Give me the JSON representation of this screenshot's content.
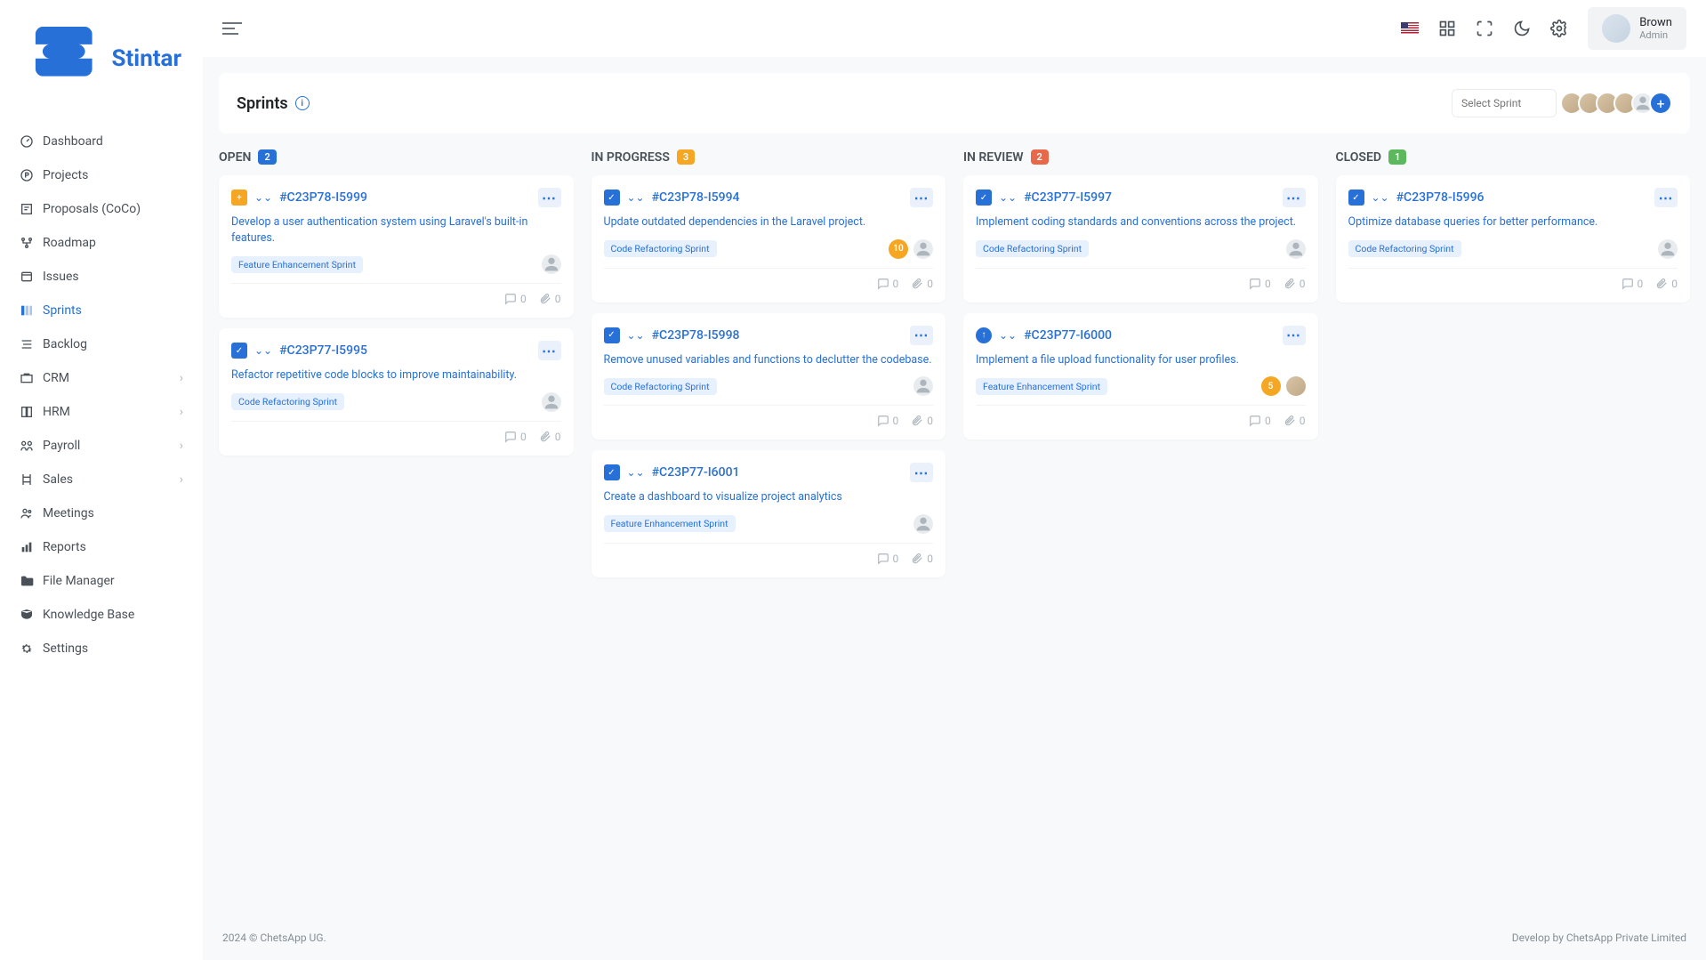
{
  "app": {
    "name": "Stintar"
  },
  "user": {
    "name": "Brown",
    "role": "Admin"
  },
  "sidebar": {
    "items": [
      {
        "label": "Dashboard",
        "icon": "gauge"
      },
      {
        "label": "Projects",
        "icon": "p-circle"
      },
      {
        "label": "Proposals (CoCo)",
        "icon": "proposal"
      },
      {
        "label": "Roadmap",
        "icon": "roadmap"
      },
      {
        "label": "Issues",
        "icon": "issues"
      },
      {
        "label": "Sprints",
        "icon": "sprints",
        "active": true
      },
      {
        "label": "Backlog",
        "icon": "backlog"
      },
      {
        "label": "CRM",
        "icon": "crm",
        "expandable": true
      },
      {
        "label": "HRM",
        "icon": "hrm",
        "expandable": true
      },
      {
        "label": "Payroll",
        "icon": "payroll",
        "expandable": true
      },
      {
        "label": "Sales",
        "icon": "sales",
        "expandable": true
      },
      {
        "label": "Meetings",
        "icon": "meetings"
      },
      {
        "label": "Reports",
        "icon": "reports"
      },
      {
        "label": "File Manager",
        "icon": "folder"
      },
      {
        "label": "Knowledge Base",
        "icon": "kb"
      },
      {
        "label": "Settings",
        "icon": "gear"
      }
    ]
  },
  "page": {
    "title": "Sprints",
    "select_placeholder": "Select Sprint"
  },
  "columns": [
    {
      "title": "OPEN",
      "count": "2",
      "badge": "blue"
    },
    {
      "title": "IN PROGRESS",
      "count": "3",
      "badge": "orange"
    },
    {
      "title": "IN REVIEW",
      "count": "2",
      "badge": "red"
    },
    {
      "title": "CLOSED",
      "count": "1",
      "badge": "green"
    }
  ],
  "cards": {
    "open": [
      {
        "id": "#C23P78-I5999",
        "type": "new",
        "desc": "Develop a user authentication system using Laravel's built-in features.",
        "tag": "Feature Enhancement Sprint",
        "comments": "0",
        "attachments": "0"
      },
      {
        "id": "#C23P77-I5995",
        "type": "task",
        "desc": "Refactor repetitive code blocks to improve maintainability.",
        "tag": "Code Refactoring Sprint",
        "comments": "0",
        "attachments": "0"
      }
    ],
    "inprogress": [
      {
        "id": "#C23P78-I5994",
        "type": "task",
        "desc": "Update outdated dependencies in the Laravel project.",
        "tag": "Code Refactoring Sprint",
        "count": "10",
        "countColor": "y",
        "comments": "0",
        "attachments": "0"
      },
      {
        "id": "#C23P78-I5998",
        "type": "task",
        "desc": "Remove unused variables and functions to declutter the codebase.",
        "tag": "Code Refactoring Sprint",
        "comments": "0",
        "attachments": "0"
      },
      {
        "id": "#C23P77-I6001",
        "type": "task",
        "desc": "Create a dashboard to visualize project analytics",
        "tag": "Feature Enhancement Sprint",
        "comments": "0",
        "attachments": "0"
      }
    ],
    "inreview": [
      {
        "id": "#C23P77-I5997",
        "type": "task",
        "desc": "Implement coding standards and conventions across the project.",
        "tag": "Code Refactoring Sprint",
        "comments": "0",
        "attachments": "0"
      },
      {
        "id": "#C23P77-I6000",
        "type": "up",
        "desc": "Implement a file upload functionality for user profiles.",
        "tag": "Feature Enhancement Sprint",
        "count": "5",
        "countColor": "o",
        "hasAvatar": true,
        "comments": "0",
        "attachments": "0"
      }
    ],
    "closed": [
      {
        "id": "#C23P78-I5996",
        "type": "task",
        "desc": "Optimize database queries for better performance.",
        "tag": "Code Refactoring Sprint",
        "comments": "0",
        "attachments": "0"
      }
    ]
  },
  "footer": {
    "left": "2024 © ChetsApp UG.",
    "right": "Develop by ChetsApp Private Limited"
  }
}
